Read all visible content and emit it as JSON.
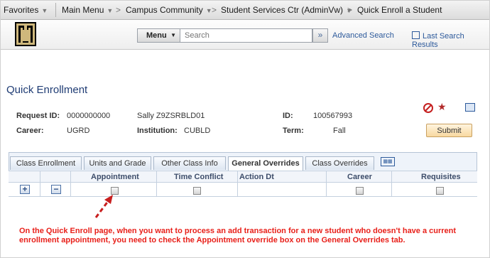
{
  "breadcrumb": {
    "favorites": "Favorites",
    "main_menu": "Main Menu",
    "campus_community": "Campus Community",
    "student_services": "Student Services Ctr (AdminVw)",
    "current": "Quick Enroll a Student"
  },
  "search": {
    "menu_label": "Menu",
    "placeholder": "Search",
    "go_symbol": "»",
    "advanced_label": "Advanced Search",
    "last_results_label": "Last Search Results"
  },
  "page": {
    "title": "Quick Enrollment",
    "request_id_label": "Request ID:",
    "request_id_value": "0000000000",
    "student_name": "Sally Z9ZSRBLD01",
    "id_label": "ID:",
    "id_value": "100567993",
    "career_label": "Career:",
    "career_value": "UGRD",
    "institution_label": "Institution:",
    "institution_value": "CUBLD",
    "term_label": "Term:",
    "term_value": "Fall",
    "submit_label": "Submit"
  },
  "tabs": [
    {
      "label": "Class Enrollment"
    },
    {
      "label": "Units and Grade"
    },
    {
      "label": "Other Class Info"
    },
    {
      "label": "General Overrides"
    },
    {
      "label": "Class Overrides"
    }
  ],
  "active_tab": "General Overrides",
  "grid": {
    "columns": [
      "Appointment",
      "Time Conflict",
      "Action Dt",
      "Career",
      "Requisites"
    ],
    "add_symbol": "+",
    "remove_symbol": "−"
  },
  "annotation": {
    "text": "On the Quick Enroll page, when you want to process  an add transaction  for a new student  who doesn't have a current enrollment appointment, you need to check the Appointment override box on the General Overrides tab.",
    "color": "#e8201a"
  },
  "colors": {
    "title": "#1f3c74",
    "link": "#2d5a9b",
    "submit_bg": "#f8d9a0"
  }
}
